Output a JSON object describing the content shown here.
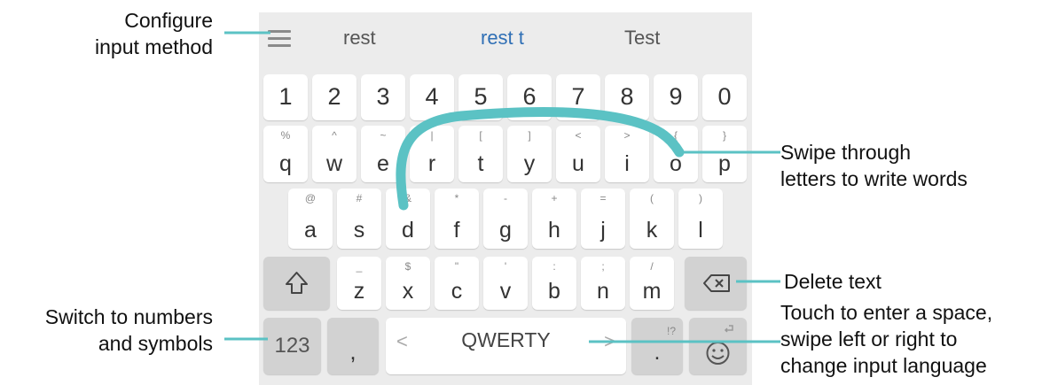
{
  "callouts": {
    "configure_line1": "Configure",
    "configure_line2": "input method",
    "swipe_line1": "Swipe through",
    "swipe_line2": "letters to write words",
    "delete": "Delete text",
    "numbers_line1": "Switch to numbers",
    "numbers_line2": "and symbols",
    "space_line1": "Touch to enter a space,",
    "space_line2": "swipe left or right to",
    "space_line3": "change input language"
  },
  "suggestions": [
    "rest",
    "rest t",
    "Test"
  ],
  "menu_icon": "menu-icon",
  "number_row": [
    "1",
    "2",
    "3",
    "4",
    "5",
    "6",
    "7",
    "8",
    "9",
    "0"
  ],
  "row_q": [
    {
      "main": "q",
      "sub": "%"
    },
    {
      "main": "w",
      "sub": "^"
    },
    {
      "main": "e",
      "sub": "~"
    },
    {
      "main": "r",
      "sub": "|"
    },
    {
      "main": "t",
      "sub": "["
    },
    {
      "main": "y",
      "sub": "]"
    },
    {
      "main": "u",
      "sub": "<"
    },
    {
      "main": "i",
      "sub": ">"
    },
    {
      "main": "o",
      "sub": "{"
    },
    {
      "main": "p",
      "sub": "}"
    }
  ],
  "row_a": [
    {
      "main": "a",
      "sub": "@"
    },
    {
      "main": "s",
      "sub": "#"
    },
    {
      "main": "d",
      "sub": "&"
    },
    {
      "main": "f",
      "sub": "*"
    },
    {
      "main": "g",
      "sub": "-"
    },
    {
      "main": "h",
      "sub": "+"
    },
    {
      "main": "j",
      "sub": "="
    },
    {
      "main": "k",
      "sub": "("
    },
    {
      "main": "l",
      "sub": ")"
    }
  ],
  "row_z": [
    {
      "main": "z",
      "sub": "_"
    },
    {
      "main": "x",
      "sub": "$"
    },
    {
      "main": "c",
      "sub": "\""
    },
    {
      "main": "v",
      "sub": "'"
    },
    {
      "main": "b",
      "sub": ":"
    },
    {
      "main": "n",
      "sub": ";"
    },
    {
      "main": "m",
      "sub": "/"
    }
  ],
  "bottom": {
    "numbers_key": "123",
    "comma_key": ",",
    "space_key": "QWERTY",
    "space_left": "<",
    "space_right": ">",
    "period_key": ".",
    "period_sub": "!?"
  },
  "colors": {
    "accent": "#5bc2c4",
    "keyboard_bg": "#ececec",
    "key_bg": "#ffffff",
    "dark_key_bg": "#d2d2d2",
    "suggestion_highlight": "#2f6fb5"
  },
  "icons": {
    "shift": "shift-icon",
    "backspace": "backspace-icon",
    "emoji": "emoji-icon"
  }
}
